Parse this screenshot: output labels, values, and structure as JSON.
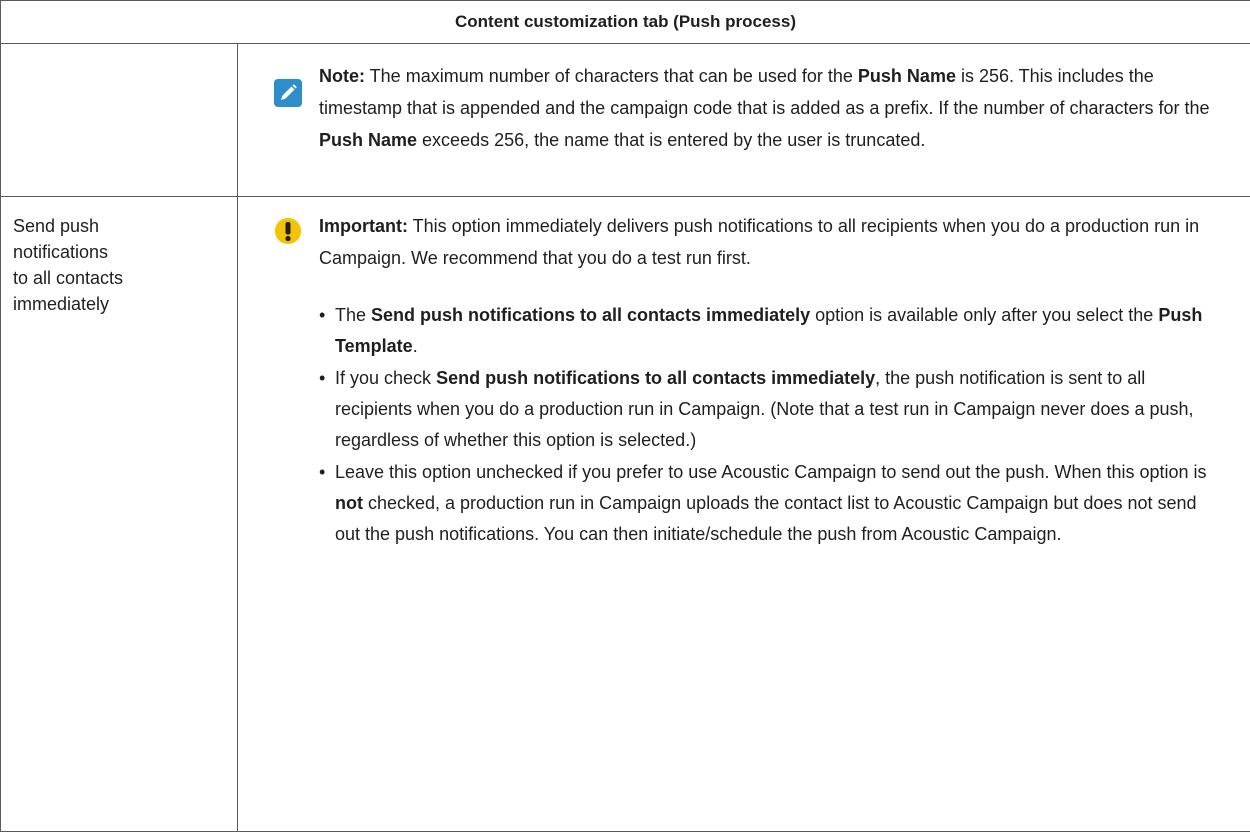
{
  "table": {
    "header": "Content customization tab (Push process)"
  },
  "note": {
    "icon": "pencil-icon",
    "icon_color": "#2d8fca",
    "label": "Note:",
    "t1": " The maximum number of characters that can be used for the ",
    "b1": "Push Name",
    "t2": " is 256. This includes the timestamp that is appended and the campaign code that is added as a prefix. If the number of characters for the ",
    "b2": "Push Name",
    "t3": " exceeds 256, the name that is entered by the user is truncated."
  },
  "row2": {
    "left_label": "Send push notifications to all contacts immediately",
    "left_lines": [
      "Send push",
      "notifications",
      "to all contacts",
      "immediately"
    ]
  },
  "important": {
    "icon": "exclamation-icon",
    "icon_color": "#f5c400",
    "label": "Important:",
    "text": " This option immediately delivers push notifications to all recipients when you do a production run in Campaign. We recommend that you do a test run first."
  },
  "bullets": [
    {
      "t1": "The ",
      "b1": "Send push notifications to all contacts immediately",
      "t2": " option is available only after you select the ",
      "b2": "Push Template",
      "t3": "."
    },
    {
      "t1": "If you check ",
      "b1": "Send push notifications to all contacts immediately",
      "t2": ", the push notification is sent to all recipients when you do a production run in Campaign. (Note that a test run in Campaign never does a push, regardless of whether this option is selected.)"
    },
    {
      "t1": "Leave this option unchecked if you prefer to use Acoustic Campaign to send out the push. When this option is ",
      "b1": "not",
      "t2": " checked, a production run in Campaign uploads the contact list to Acoustic Campaign but does not send out the push notifications. You can then initiate/schedule the push from Acoustic Campaign."
    }
  ]
}
